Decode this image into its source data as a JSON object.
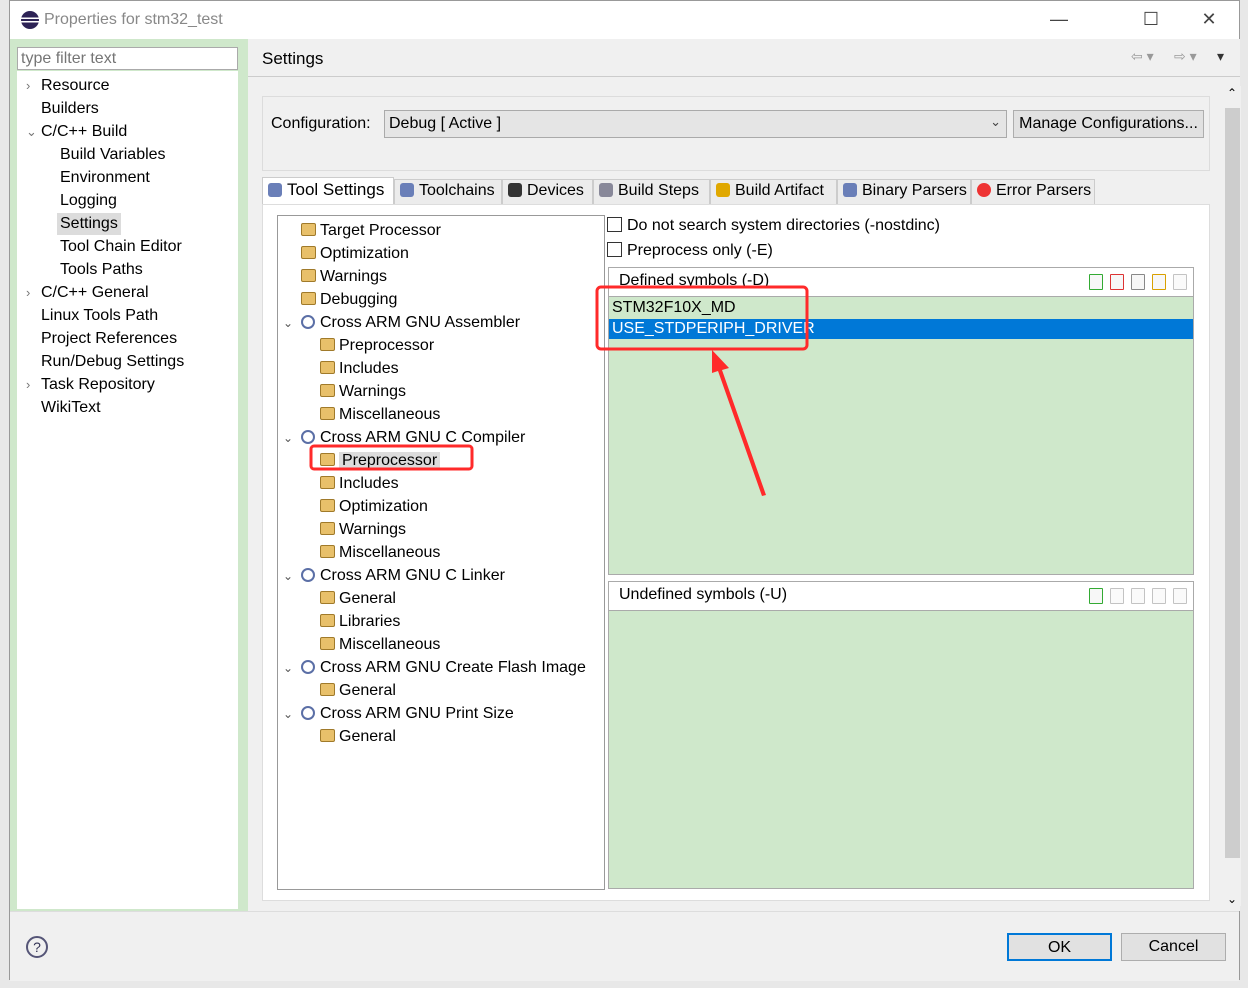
{
  "window": {
    "title": "Properties for stm32_test",
    "minimize": "—",
    "maximize": "☐",
    "close": "✕"
  },
  "filter": {
    "placeholder": "type filter text"
  },
  "nav": [
    {
      "label": "Resource",
      "level": 0,
      "chevron": "›"
    },
    {
      "label": "Builders",
      "level": 0
    },
    {
      "label": "C/C++ Build",
      "level": 0,
      "chevron": "⌄"
    },
    {
      "label": "Build Variables",
      "level": 1
    },
    {
      "label": "Environment",
      "level": 1
    },
    {
      "label": "Logging",
      "level": 1
    },
    {
      "label": "Settings",
      "level": 1,
      "selected": true
    },
    {
      "label": "Tool Chain Editor",
      "level": 1
    },
    {
      "label": "Tools Paths",
      "level": 1
    },
    {
      "label": "C/C++ General",
      "level": 0,
      "chevron": "›"
    },
    {
      "label": "Linux Tools Path",
      "level": 0
    },
    {
      "label": "Project References",
      "level": 0
    },
    {
      "label": "Run/Debug Settings",
      "level": 0
    },
    {
      "label": "Task Repository",
      "level": 0,
      "chevron": "›"
    },
    {
      "label": "WikiText",
      "level": 0
    }
  ],
  "header": {
    "title": "Settings"
  },
  "config": {
    "label": "Configuration:",
    "value": "Debug  [ Active ]",
    "manage_label": "Manage Configurations..."
  },
  "tabs": [
    {
      "label": "Tool Settings",
      "icon": "gear-icon",
      "active": true
    },
    {
      "label": "Toolchains",
      "icon": "gear-icon"
    },
    {
      "label": "Devices",
      "icon": "chip-icon"
    },
    {
      "label": "Build Steps",
      "icon": "hammer-icon"
    },
    {
      "label": "Build Artifact",
      "icon": "trophy-icon"
    },
    {
      "label": "Binary Parsers",
      "icon": "binary-icon"
    },
    {
      "label": "Error Parsers",
      "icon": "error-icon"
    }
  ],
  "tool_tree": [
    {
      "label": "Target Processor",
      "level": 1
    },
    {
      "label": "Optimization",
      "level": 1
    },
    {
      "label": "Warnings",
      "level": 1
    },
    {
      "label": "Debugging",
      "level": 1
    },
    {
      "label": "Cross ARM GNU Assembler",
      "level": 0
    },
    {
      "label": "Preprocessor",
      "level": 2
    },
    {
      "label": "Includes",
      "level": 2
    },
    {
      "label": "Warnings",
      "level": 2
    },
    {
      "label": "Miscellaneous",
      "level": 2
    },
    {
      "label": "Cross ARM GNU C Compiler",
      "level": 0
    },
    {
      "label": "Preprocessor",
      "level": 2,
      "selected": true
    },
    {
      "label": "Includes",
      "level": 2
    },
    {
      "label": "Optimization",
      "level": 2
    },
    {
      "label": "Warnings",
      "level": 2
    },
    {
      "label": "Miscellaneous",
      "level": 2
    },
    {
      "label": "Cross ARM GNU C Linker",
      "level": 0
    },
    {
      "label": "General",
      "level": 2
    },
    {
      "label": "Libraries",
      "level": 2
    },
    {
      "label": "Miscellaneous",
      "level": 2
    },
    {
      "label": "Cross ARM GNU Create Flash Image",
      "level": 0
    },
    {
      "label": "General",
      "level": 2
    },
    {
      "label": "Cross ARM GNU Print Size",
      "level": 0
    },
    {
      "label": "General",
      "level": 2
    }
  ],
  "options": {
    "nostdinc": {
      "label": "Do not search system directories (-nostdinc)",
      "checked": false
    },
    "preprocess_only": {
      "label": "Preprocess only (-E)",
      "checked": false
    }
  },
  "defined": {
    "title": "Defined symbols (-D)",
    "symbols": [
      "STM32F10X_MD",
      "USE_STDPERIPH_DRIVER"
    ],
    "selected_index": 1
  },
  "undefined": {
    "title": "Undefined symbols (-U)",
    "symbols": []
  },
  "buttons": {
    "ok": "OK",
    "cancel": "Cancel",
    "help": "?"
  },
  "colors": {
    "list_bg": "#cfe8cb",
    "selection": "#0078d7",
    "annotation": "#ff2a2a"
  }
}
